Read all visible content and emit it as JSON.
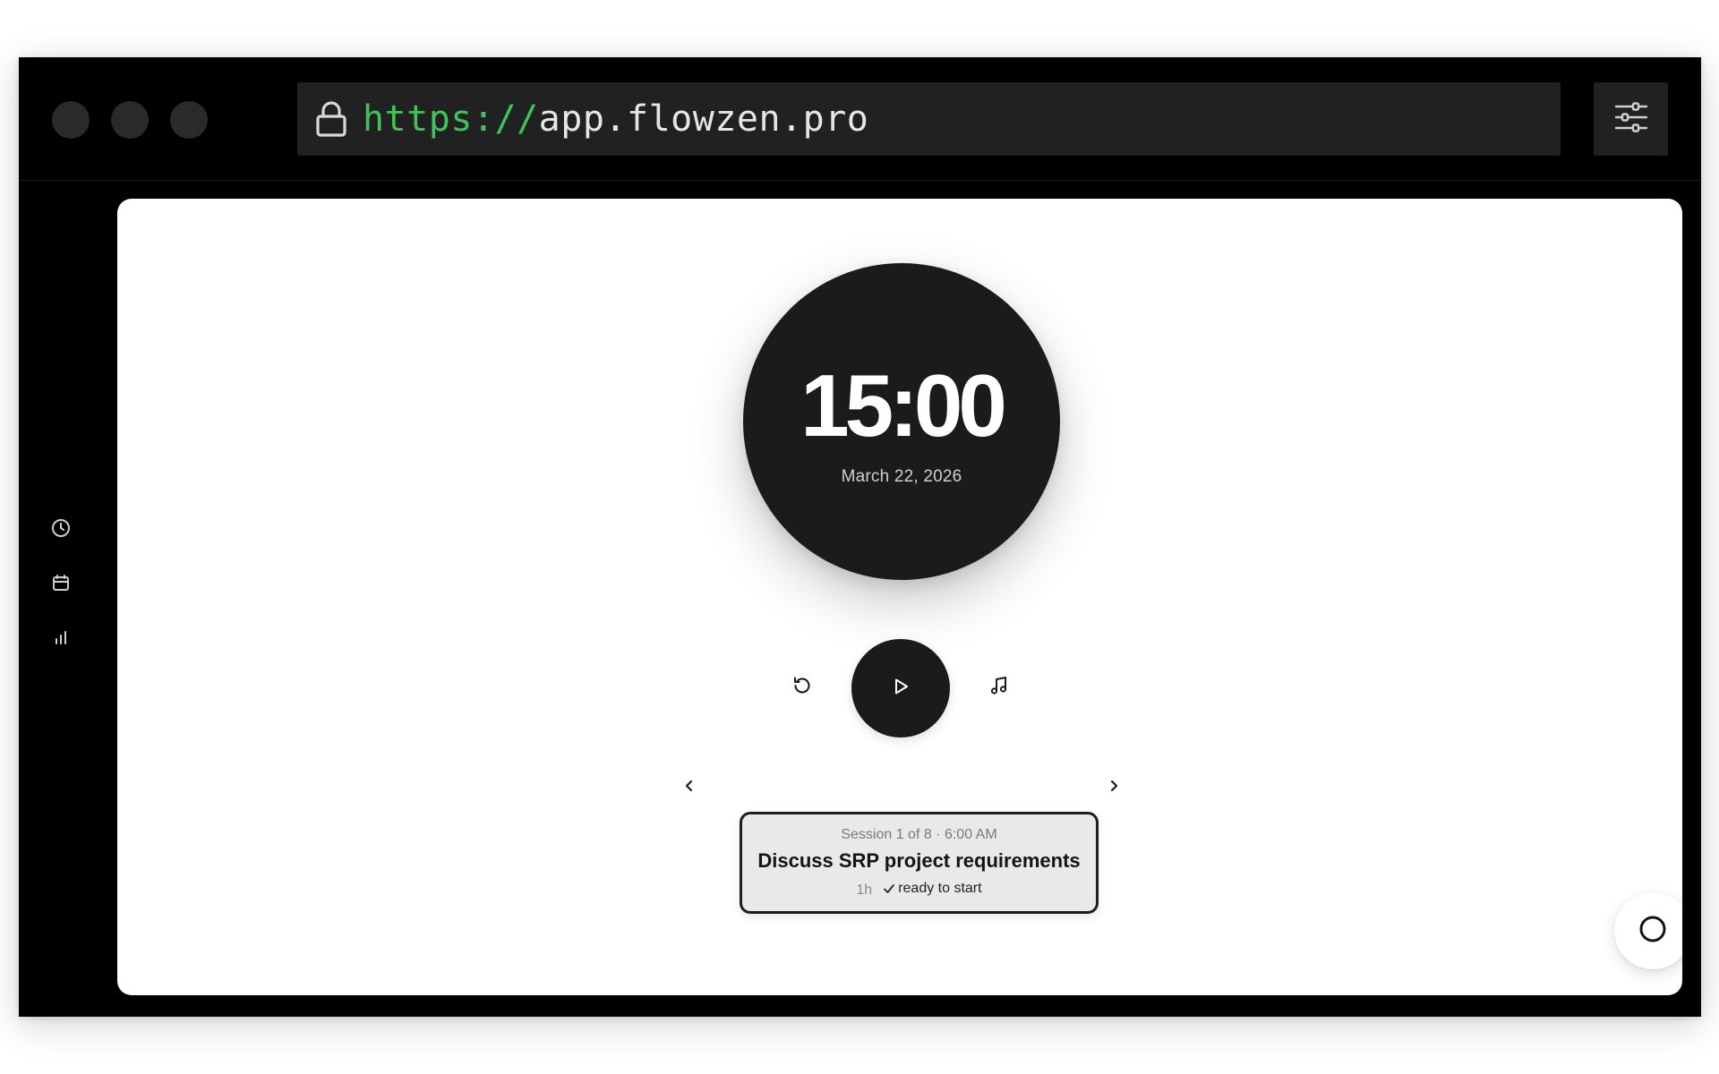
{
  "browser": {
    "url_scheme": "https://",
    "url_host": "app.flowzen.pro",
    "icons": {
      "lock": "lock-icon",
      "settings": "sliders-icon"
    }
  },
  "sidebar": {
    "items": [
      {
        "name": "timer",
        "icon": "clock-icon"
      },
      {
        "name": "calendar",
        "icon": "calendar-icon"
      },
      {
        "name": "stats",
        "icon": "bar-chart-icon"
      }
    ]
  },
  "timer": {
    "time": "15:00",
    "date": "March 22, 2026"
  },
  "controls": {
    "reset_icon": "reset-icon",
    "play_icon": "play-icon",
    "music_icon": "music-note-icon"
  },
  "session": {
    "meta": "Session 1 of 8 · 6:00 AM",
    "title": "Discuss SRP project requirements",
    "duration": "1h",
    "status": "ready to start"
  },
  "colors": {
    "chrome": "#000000",
    "url_scheme": "#3ec45a",
    "dark_surface": "#1b1b1c",
    "card_bg": "#e9e9e9"
  }
}
